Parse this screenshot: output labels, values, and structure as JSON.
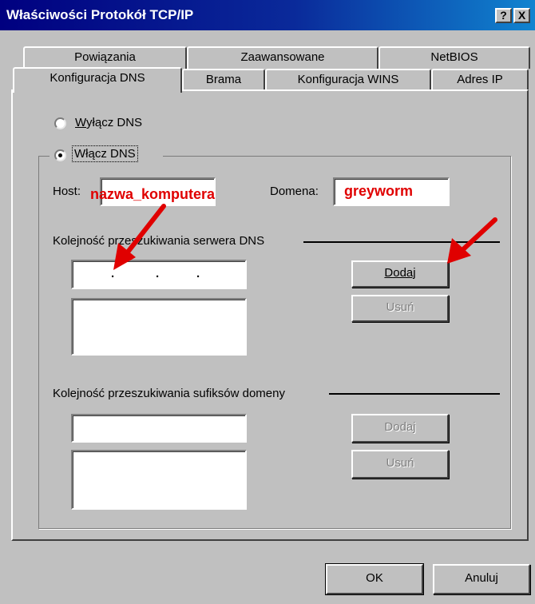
{
  "window": {
    "title": "Właściwości Protokół TCP/IP",
    "help_btn": "?",
    "close_btn": "X"
  },
  "tabs_row1": [
    "Powiązania",
    "Zaawansowane",
    "NetBIOS"
  ],
  "tabs_row2": [
    "Konfiguracja DNS",
    "Brama",
    "Konfiguracja WINS",
    "Adres IP"
  ],
  "dns": {
    "disable_label": "Wyłącz DNS",
    "enable_label": "Włącz DNS",
    "selected": "enable",
    "host_label": "Host:",
    "host_value": "nazwa_komputera",
    "domain_label": "Domena:",
    "domain_value": "greyworm",
    "server_order_label": "Kolejność przeszukiwania serwera DNS",
    "ip_separator": ".",
    "add_label": "Dodaj",
    "remove_label": "Usuń",
    "suffix_order_label": "Kolejność przeszukiwania sufiksów domeny",
    "suffix_add_label": "Dodaj",
    "suffix_remove_label": "Usuń"
  },
  "footer": {
    "ok_label": "OK",
    "cancel_label": "Anuluj"
  },
  "colors": {
    "titlebar_start": "#000080",
    "titlebar_end": "#1084d0",
    "face": "#c0c0c0",
    "highlight_text": "#e00000",
    "annotation_arrow": "#e00000"
  }
}
